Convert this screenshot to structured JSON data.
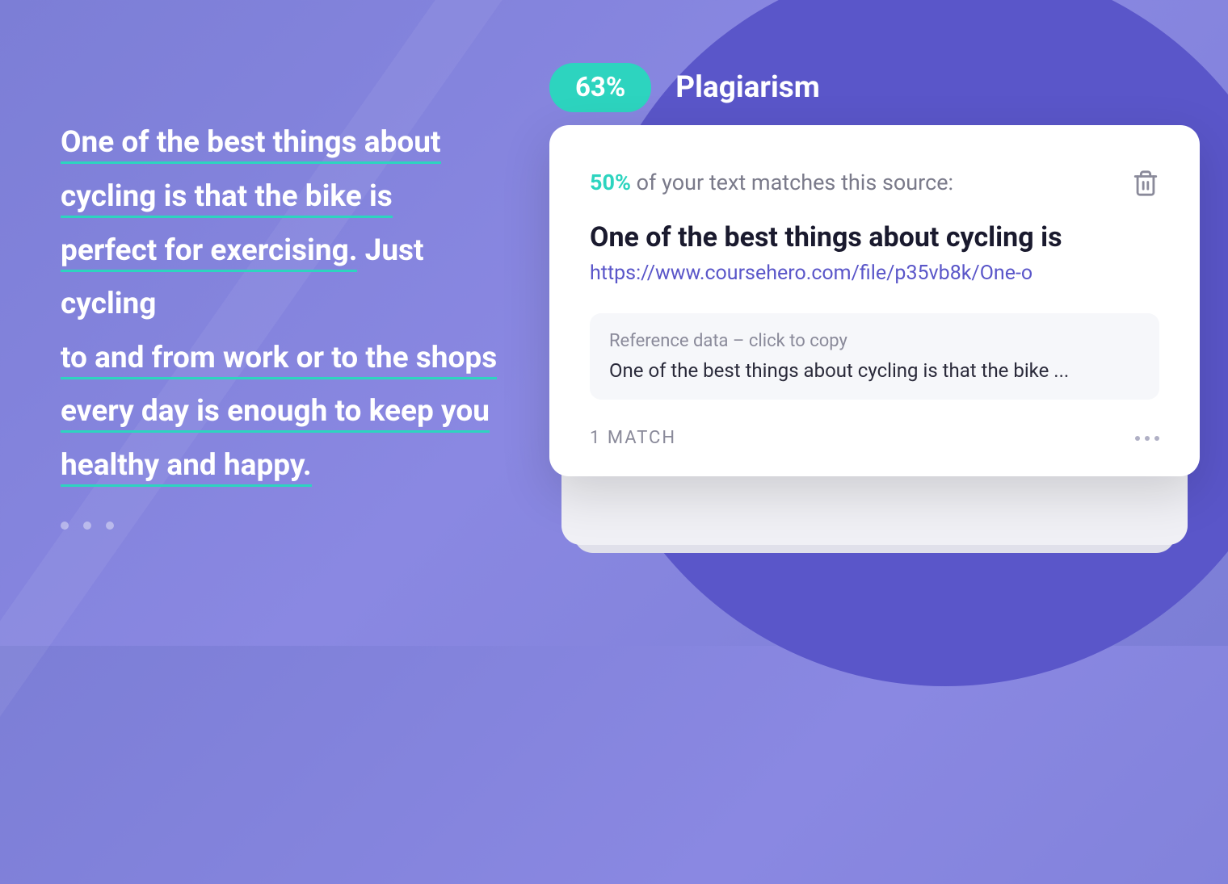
{
  "sample": {
    "line1": "One of the best things about",
    "line2": "cycling is that the bike is",
    "line3a": "perfect for exercising.",
    "line3b": " Just cycling",
    "line4": "to and from work or to the shops",
    "line5": "every day is enough to keep you",
    "line6": "healthy and happy."
  },
  "score": {
    "percent": "63%",
    "label": "Plagiarism"
  },
  "card": {
    "match_percent": "50%",
    "match_suffix": " of your text matches this source:",
    "source_title": "One of the best things about cycling is",
    "source_url": "https://www.coursehero.com/file/p35vb8k/One-o",
    "ref_label": "Reference data – click to copy",
    "ref_text": "One of the best things about cycling is that the bike ...",
    "match_count": "1 MATCH"
  }
}
